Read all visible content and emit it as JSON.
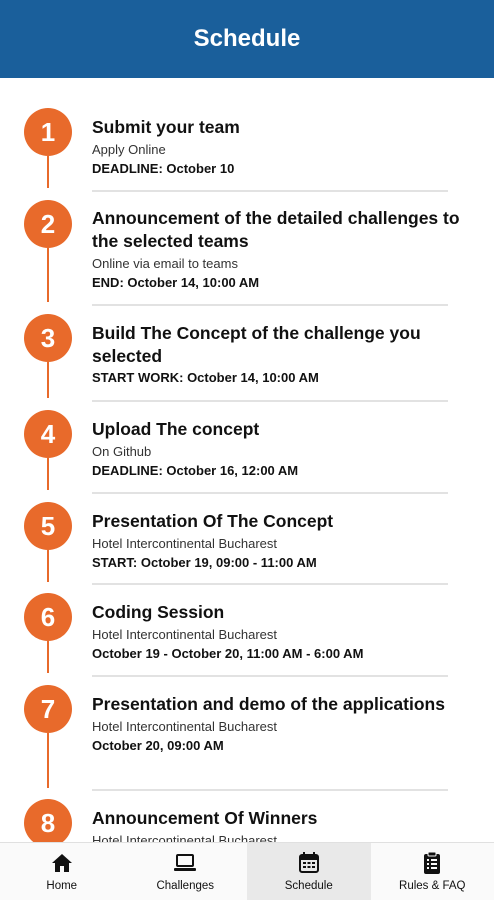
{
  "header": {
    "title": "Schedule"
  },
  "schedule": [
    {
      "number": "1",
      "title": "Submit your team",
      "subtitle": "Apply Online",
      "detail": "DEADLINE: October 10"
    },
    {
      "number": "2",
      "title": "Announcement of the detailed challenges to the selected teams",
      "subtitle": "Online via email to teams",
      "detail": "END: October 14, 10:00 AM"
    },
    {
      "number": "3",
      "title": "Build The Concept of the challenge you selected",
      "subtitle": "",
      "detail": "START WORK: October 14, 10:00 AM"
    },
    {
      "number": "4",
      "title": "Upload The concept",
      "subtitle": "On Github",
      "detail": "DEADLINE: October 16, 12:00 AM"
    },
    {
      "number": "5",
      "title": "Presentation Of The Concept",
      "subtitle": "Hotel Intercontinental Bucharest",
      "detail": "START: October 19, 09:00 - 11:00 AM"
    },
    {
      "number": "6",
      "title": "Coding Session",
      "subtitle": "Hotel Intercontinental Bucharest",
      "detail": "October 19 - October 20, 11:00 AM - 6:00 AM"
    },
    {
      "number": "7",
      "title": "Presentation and demo of the applications",
      "subtitle": "Hotel Intercontinental Bucharest",
      "detail": "October 20, 09:00 AM"
    },
    {
      "number": "8",
      "title": "Announcement Of Winners",
      "subtitle": "Hotel Intercontinental Bucharest",
      "detail": ""
    }
  ],
  "nav": {
    "items": [
      {
        "label": "Home",
        "icon": "home-icon"
      },
      {
        "label": "Challenges",
        "icon": "laptop-icon"
      },
      {
        "label": "Schedule",
        "icon": "calendar-icon",
        "active": true
      },
      {
        "label": "Rules & FAQ",
        "icon": "clipboard-icon"
      }
    ]
  },
  "colors": {
    "header": "#1a5f9b",
    "accent": "#e86a2b"
  }
}
